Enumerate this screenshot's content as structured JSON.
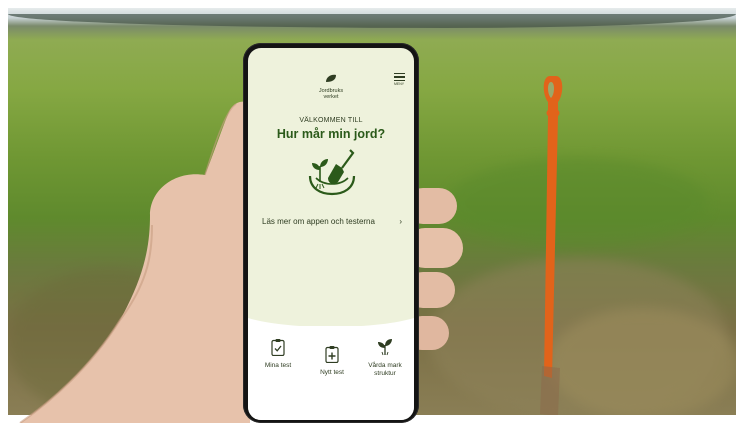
{
  "app": {
    "logo_text": "Jordbruks\nverket",
    "menu_label": "MENY",
    "welcome": "VÄLKOMMEN TILL",
    "headline": "Hur mår min jord?",
    "learn_more": "Läs mer om appen och testerna",
    "learn_more_arrow": "›",
    "tabs": [
      {
        "label": "Mina test",
        "icon": "clipboard-check-icon"
      },
      {
        "label": "Nytt test",
        "icon": "clipboard-plus-icon"
      },
      {
        "label": "Vårda mark\nstruktur",
        "icon": "sprout-icon"
      }
    ]
  },
  "colors": {
    "screen_bg": "#eef2dc",
    "brand_green": "#2b5a1a",
    "text_dark": "#2f3d22",
    "tabbar_bg": "#ffffff",
    "spade_orange": "#e2631a"
  }
}
